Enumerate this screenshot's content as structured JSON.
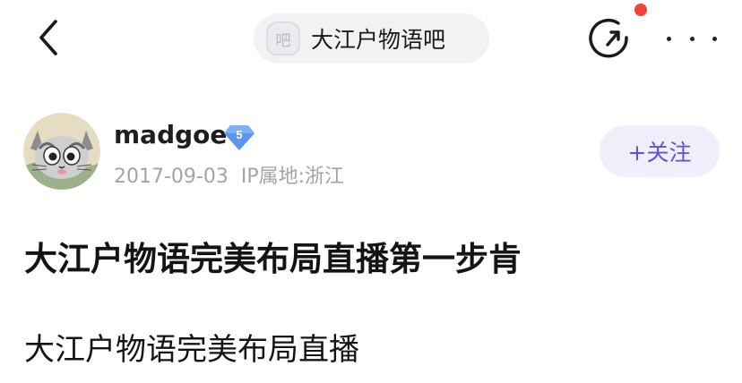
{
  "header": {
    "forum_icon_text": "吧",
    "forum_name": "大江户物语吧",
    "has_notification": true,
    "colors": {
      "notification_dot": "#f2403a",
      "pill_background": "#f2f2f5"
    }
  },
  "author": {
    "name": "madgoe",
    "level": "5",
    "date": "2017-09-03",
    "ip_location": "IP属地:浙江",
    "follow_label": "+关注",
    "colors": {
      "follow_text": "#5b54d6",
      "follow_background": "#f0eefa",
      "badge": "#5b95f2"
    }
  },
  "post": {
    "title": "大江户物语完美布局直播第一步肯",
    "body": "大江户物语完美布局直播"
  }
}
